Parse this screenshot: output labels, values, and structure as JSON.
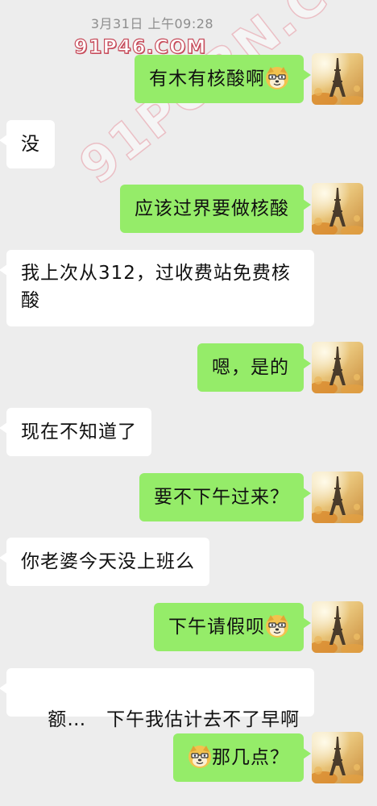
{
  "chat": {
    "timestamp": "3月31日 上午09:28",
    "watermark": "91P46.COM",
    "watermark_diag": "91PORN.COM",
    "messages": [
      {
        "side": "right",
        "text": "有木有核酸啊",
        "emoji": "doge-emoji"
      },
      {
        "side": "left",
        "text": "没"
      },
      {
        "side": "right",
        "text": "应该过界要做核酸"
      },
      {
        "side": "left",
        "lines": [
          "我上次从312，过收费站免费核",
          "酸"
        ]
      },
      {
        "side": "right",
        "text": "嗯，是的"
      },
      {
        "side": "left",
        "text": "现在不知道了"
      },
      {
        "side": "right",
        "text": "要不下午过来？"
      },
      {
        "side": "left",
        "text": "你老婆今天没上班么"
      },
      {
        "side": "right",
        "text": "下午请假呗",
        "emoji": "doge-emoji"
      },
      {
        "side": "left",
        "text": "额…   下午我估计去不了早啊"
      },
      {
        "side": "right",
        "text": "那几点？",
        "emoji_prefix": "doge-emoji"
      }
    ]
  },
  "colors": {
    "background": "#ededed",
    "sent_bubble": "#95ec69",
    "received_bubble": "#ffffff"
  }
}
